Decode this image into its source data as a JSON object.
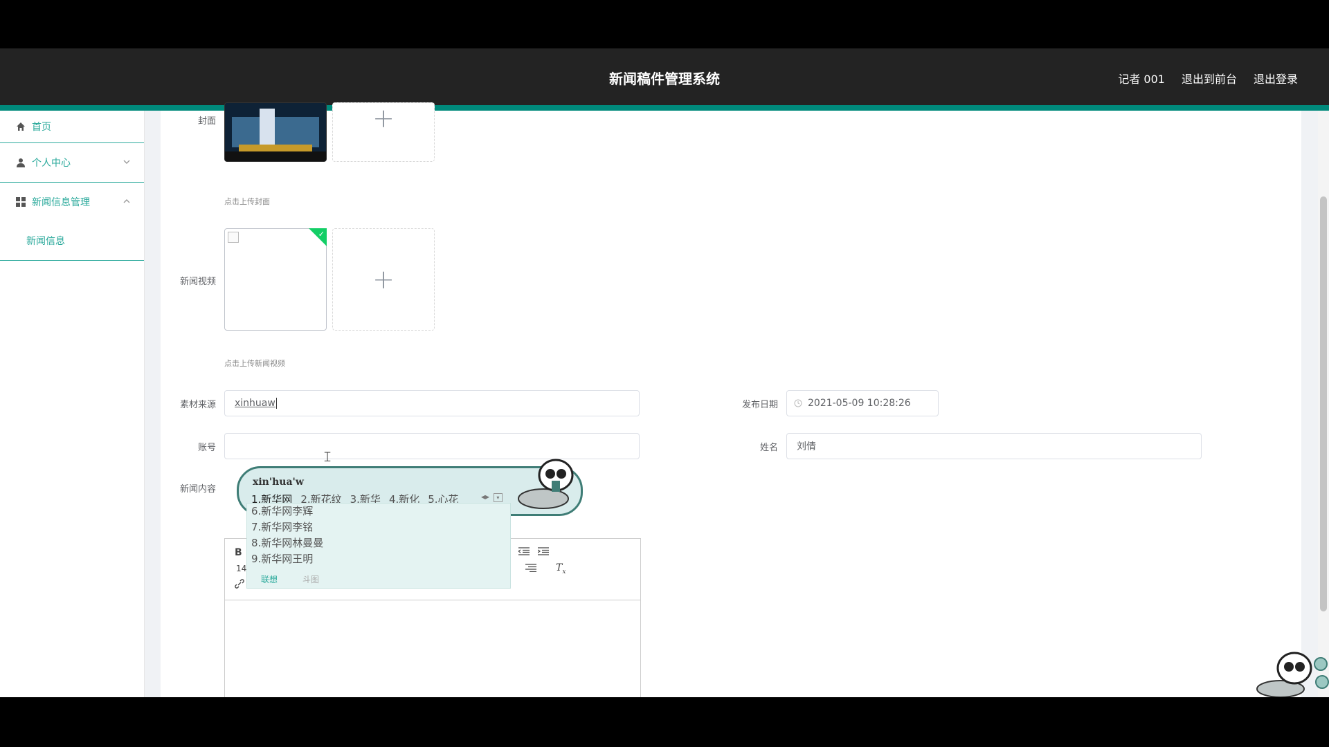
{
  "header": {
    "title": "新闻稿件管理系统",
    "user": "记者 001",
    "to_frontend": "退出到前台",
    "logout": "退出登录"
  },
  "sidebar": {
    "items": [
      {
        "label": "首页",
        "icon": "home-icon"
      },
      {
        "label": "个人中心",
        "icon": "user-icon",
        "chevron": "chevron-down-icon"
      },
      {
        "label": "新闻信息管理",
        "icon": "grid-icon",
        "chevron": "chevron-up-icon"
      }
    ],
    "submenu": {
      "label": "新闻信息"
    }
  },
  "form": {
    "cover_label": "封面",
    "cover_hint": "点击上传封面",
    "video_label": "新闻视频",
    "video_hint": "点击上传新闻视频",
    "source_label": "素材来源",
    "source_value": "xinhuaw",
    "date_label": "发布日期",
    "date_value": "2021-05-09 10:28:26",
    "account_label": "账号",
    "name_label": "姓名",
    "name_value": "刘倩",
    "content_label": "新闻内容"
  },
  "editor": {
    "bold": "B",
    "font_size": "14"
  },
  "ime": {
    "pinyin": "xin'hua'w",
    "candidates": [
      "1.新华网",
      "2.新花纹",
      "3.新华",
      "4.新化",
      "5.心花"
    ],
    "more": [
      "6.新华网李辉",
      "7.新华网李铭",
      "8.新华网林曼曼",
      "9.新华网王明"
    ],
    "tab_assoc": "联想",
    "tab_sticker": "斗图"
  },
  "colors": {
    "accent": "#2aa99b",
    "header_bg": "#232323",
    "accent_bar": "#00897b"
  }
}
